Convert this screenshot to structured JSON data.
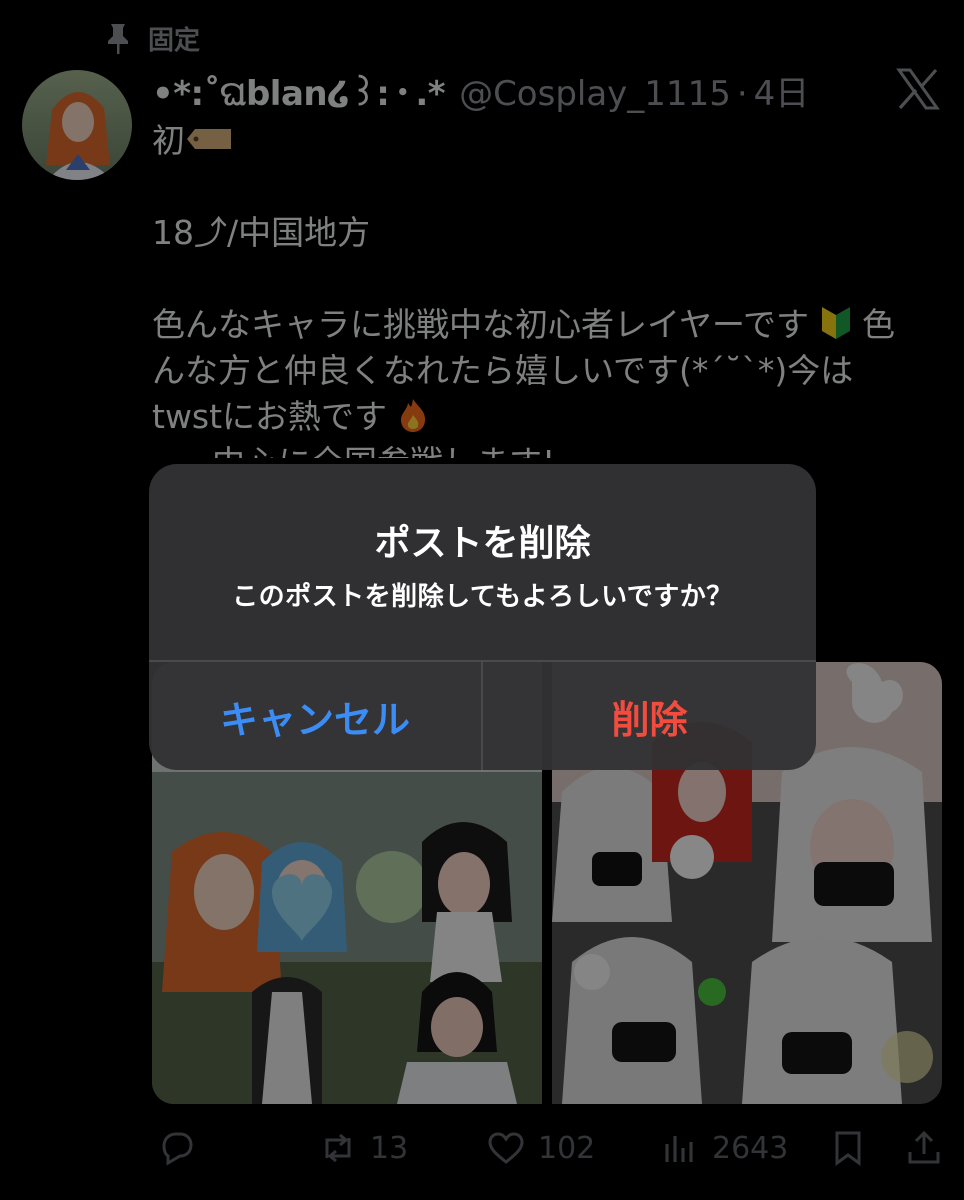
{
  "pinned": {
    "label": "固定"
  },
  "post": {
    "display_name": "•*:˚ଘblan໒꒱:・.*",
    "handle": "@Cosplay_1115",
    "separator": "·",
    "time": "4日",
    "lines": {
      "intro": "初",
      "region": "18⤴/中国地方",
      "bio_1": "色んなキャラに挑戦中な初心者レイヤーです",
      "bio_2": "色",
      "bio_3": "んな方と仲良くなれたら嬉しいです(*´˘`*)今は",
      "bio_4": "twstにお熱です",
      "bio_5": "中心に全国参戦します!"
    },
    "icons": {
      "tag": "label-tag-icon",
      "beginner": "beginner-mark-icon",
      "fire": "fire-icon"
    }
  },
  "dialog": {
    "title": "ポストを削除",
    "message": "このポストを削除してもよろしいですか？",
    "cancel_label": "キャンセル",
    "delete_label": "削除",
    "colors": {
      "cancel": "#3b8df5",
      "delete": "#f24c3e"
    }
  },
  "actions": {
    "retweets": "13",
    "likes": "102",
    "views": "2643"
  },
  "colors": {
    "background": "#000000",
    "muted": "#8b8f94"
  }
}
